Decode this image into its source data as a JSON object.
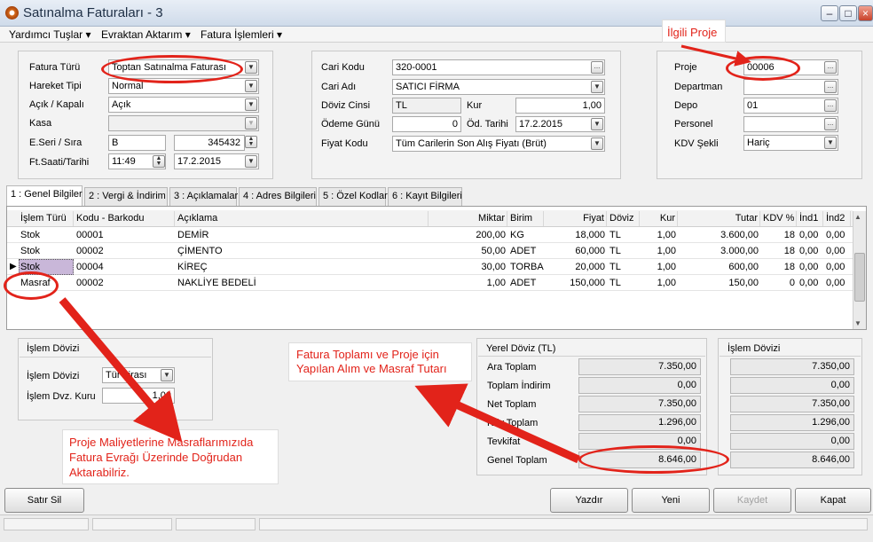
{
  "window": {
    "title": "Satınalma Faturaları - 3"
  },
  "menu": [
    "Yardımcı Tuşlar",
    "Evraktan Aktarım",
    "Fatura İşlemleri"
  ],
  "left_panel": {
    "fatura_turu_label": "Fatura Türü",
    "fatura_turu": "Toptan Satınalma Faturası",
    "hareket_tipi_label": "Hareket Tipi",
    "hareket_tipi": "Normal",
    "acik_kapali_label": "Açık / Kapalı",
    "acik_kapali": "Açık",
    "kasa_label": "Kasa",
    "kasa": "",
    "seri_sira_label": "E.Seri / Sıra",
    "seri": "B",
    "sira": "345432",
    "ft_saati_label": "Ft.Saati/Tarihi",
    "saat": "11:49",
    "tarih": "17.2.2015"
  },
  "mid_panel": {
    "cari_kodu_label": "Cari Kodu",
    "cari_kodu": "320-0001",
    "cari_adi_label": "Cari Adı",
    "cari_adi": "SATICI FİRMA",
    "doviz_cinsi_label": "Döviz Cinsi",
    "doviz_cinsi": "TL",
    "kur_label": "Kur",
    "kur": "1,00",
    "odeme_gunu_label": "Ödeme Günü",
    "odeme_gunu": "0",
    "od_tarihi_label": "Öd. Tarihi",
    "od_tarihi": "17.2.2015",
    "fiyat_kodu_label": "Fiyat Kodu",
    "fiyat_kodu": "Tüm Carilerin Son Alış Fiyatı (Brüt)"
  },
  "right_panel": {
    "proje_label": "Proje",
    "proje": "00006",
    "departman_label": "Departman",
    "departman": "",
    "depo_label": "Depo",
    "depo": "01",
    "personel_label": "Personel",
    "personel": "",
    "kdv_sekli_label": "KDV Şekli",
    "kdv_sekli": "Hariç"
  },
  "tabs": [
    "1 : Genel Bilgiler",
    "2 : Vergi & İndirim",
    "3 : Açıklamalar",
    "4 : Adres Bilgileri",
    "5 : Özel Kodlar",
    "6 : Kayıt Bilgileri"
  ],
  "grid": {
    "headers": [
      "İşlem Türü",
      "Kodu - Barkodu",
      "Açıklama",
      "Miktar",
      "Birim",
      "Fiyat",
      "Döviz",
      "Kur",
      "Tutar",
      "KDV %",
      "İnd1",
      "İnd2"
    ],
    "rows": [
      [
        "Stok",
        "00001",
        "DEMİR",
        "200,00",
        "KG",
        "18,000",
        "TL",
        "1,00",
        "3.600,00",
        "18",
        "0,00",
        "0,00"
      ],
      [
        "Stok",
        "00002",
        "ÇİMENTO",
        "50,00",
        "ADET",
        "60,000",
        "TL",
        "1,00",
        "3.000,00",
        "18",
        "0,00",
        "0,00"
      ],
      [
        "Stok",
        "00004",
        "KİREÇ",
        "30,00",
        "TORBA",
        "20,000",
        "TL",
        "1,00",
        "600,00",
        "18",
        "0,00",
        "0,00"
      ],
      [
        "Masraf",
        "00002",
        "NAKLİYE BEDELİ",
        "1,00",
        "ADET",
        "150,000",
        "TL",
        "1,00",
        "150,00",
        "0",
        "0,00",
        "0,00"
      ]
    ]
  },
  "islem_dovizi_panel": {
    "title": "İşlem Dövizi",
    "doviz_label": "İşlem Dövizi",
    "doviz_value": "Tür Lirası",
    "kur_label": "İşlem Dvz. Kuru",
    "kur_value": "1,00"
  },
  "yerel_doviz": {
    "title": "Yerel Döviz (TL)",
    "rows": [
      {
        "label": "Ara Toplam",
        "value": "7.350,00"
      },
      {
        "label": "Toplam İndirim",
        "value": "0,00"
      },
      {
        "label": "Net Toplam",
        "value": "7.350,00"
      },
      {
        "label": "Kdv Toplam",
        "value": "1.296,00"
      },
      {
        "label": "Tevkifat",
        "value": "0,00"
      },
      {
        "label": "Genel Toplam",
        "value": "8.646,00"
      }
    ]
  },
  "islem_dovizi_totals": {
    "title": "İşlem Dövizi",
    "values": [
      "7.350,00",
      "0,00",
      "7.350,00",
      "1.296,00",
      "0,00",
      "8.646,00"
    ]
  },
  "buttons": {
    "satir_sil": "Satır Sil",
    "yazdir": "Yazdır",
    "yeni": "Yeni",
    "kaydet": "Kaydet",
    "kapat": "Kapat"
  },
  "annotations": {
    "ilgili_proje": "İlgili Proje",
    "fatura_toplami": [
      "Fatura Toplamı ve Proje için",
      "Yapılan Alım ve Masraf  Tutarı"
    ],
    "proje_maliyet": [
      "Proje Maliyetlerine Masraflarımızıda",
      "Fatura Evrağı Üzerinde Doğrudan",
      "Aktarabilriz."
    ]
  },
  "colors": {
    "annotation": "#e2231a",
    "selected_cell": "#c9b7d9"
  }
}
